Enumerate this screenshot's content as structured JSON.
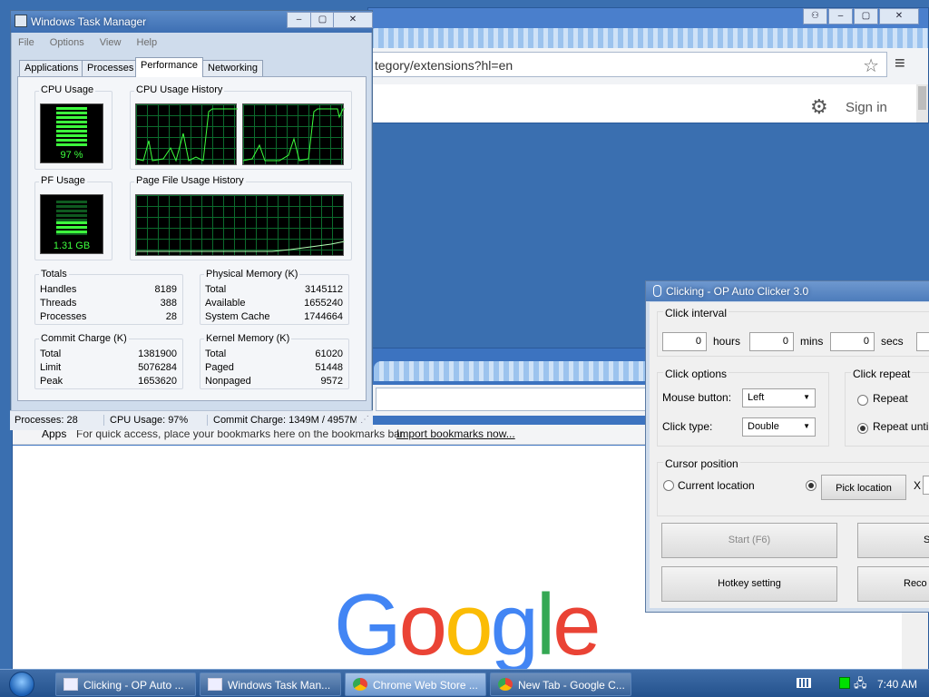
{
  "chrome_top": {
    "url": "tegory/extensions?hl=en",
    "sign_in": "Sign in"
  },
  "chrome_bottom": {
    "bookmarks_bar": {
      "apps": "Apps",
      "message": "For quick access, place your bookmarks here on the bookmarks bar.",
      "import_link": "Import bookmarks now..."
    }
  },
  "google_logo": {
    "letters": [
      "G",
      "o",
      "o",
      "g",
      "l",
      "e"
    ],
    "colors": [
      "#4285F4",
      "#EA4335",
      "#FBBC05",
      "#4285F4",
      "#34A853",
      "#EA4335"
    ]
  },
  "task_manager": {
    "title": "Windows Task Manager",
    "menu": [
      "File",
      "Options",
      "View",
      "Help"
    ],
    "tabs": [
      "Applications",
      "Processes",
      "Performance",
      "Networking"
    ],
    "active_tab": "Performance",
    "cpu_usage": {
      "label": "CPU Usage",
      "value": "97 %",
      "percent": 97
    },
    "cpu_history": {
      "label": "CPU Usage History"
    },
    "pf_usage": {
      "label": "PF Usage",
      "value": "1.31 GB",
      "fraction": 0.33
    },
    "pf_history": {
      "label": "Page File Usage History"
    },
    "totals": {
      "label": "Totals",
      "rows": [
        [
          "Handles",
          "8189"
        ],
        [
          "Threads",
          "388"
        ],
        [
          "Processes",
          "28"
        ]
      ]
    },
    "physical_memory": {
      "label": "Physical Memory (K)",
      "rows": [
        [
          "Total",
          "3145112"
        ],
        [
          "Available",
          "1655240"
        ],
        [
          "System Cache",
          "1744664"
        ]
      ]
    },
    "commit_charge": {
      "label": "Commit Charge (K)",
      "rows": [
        [
          "Total",
          "1381900"
        ],
        [
          "Limit",
          "5076284"
        ],
        [
          "Peak",
          "1653620"
        ]
      ]
    },
    "kernel_memory": {
      "label": "Kernel Memory (K)",
      "rows": [
        [
          "Total",
          "61020"
        ],
        [
          "Paged",
          "51448"
        ],
        [
          "Nonpaged",
          "9572"
        ]
      ]
    },
    "status": {
      "processes": "Processes: 28",
      "cpu": "CPU Usage: 97%",
      "commit": "Commit Charge: 1349M / 4957M"
    }
  },
  "auto_clicker": {
    "title": "Clicking - OP Auto Clicker 3.0",
    "click_interval": {
      "label": "Click interval",
      "hours": "0",
      "hours_label": "hours",
      "mins": "0",
      "mins_label": "mins",
      "secs": "0",
      "secs_label": "secs"
    },
    "click_options": {
      "label": "Click options",
      "mouse_button_label": "Mouse button:",
      "mouse_button_value": "Left",
      "click_type_label": "Click type:",
      "click_type_value": "Double"
    },
    "click_repeat": {
      "label": "Click repeat",
      "repeat": "Repeat",
      "repeat_until": "Repeat until s"
    },
    "cursor_position": {
      "label": "Cursor position",
      "current": "Current location",
      "pick": "Pick location",
      "x_label": "X"
    },
    "buttons": {
      "start": "Start (F6)",
      "stop": "S",
      "hotkey": "Hotkey setting",
      "record": "Reco"
    }
  },
  "taskbar": {
    "items": [
      {
        "label": "Clicking - OP Auto ..."
      },
      {
        "label": "Windows Task Man..."
      },
      {
        "label": "Chrome Web Store ..."
      },
      {
        "label": "New Tab - Google C..."
      }
    ],
    "clock": "7:40 AM"
  }
}
